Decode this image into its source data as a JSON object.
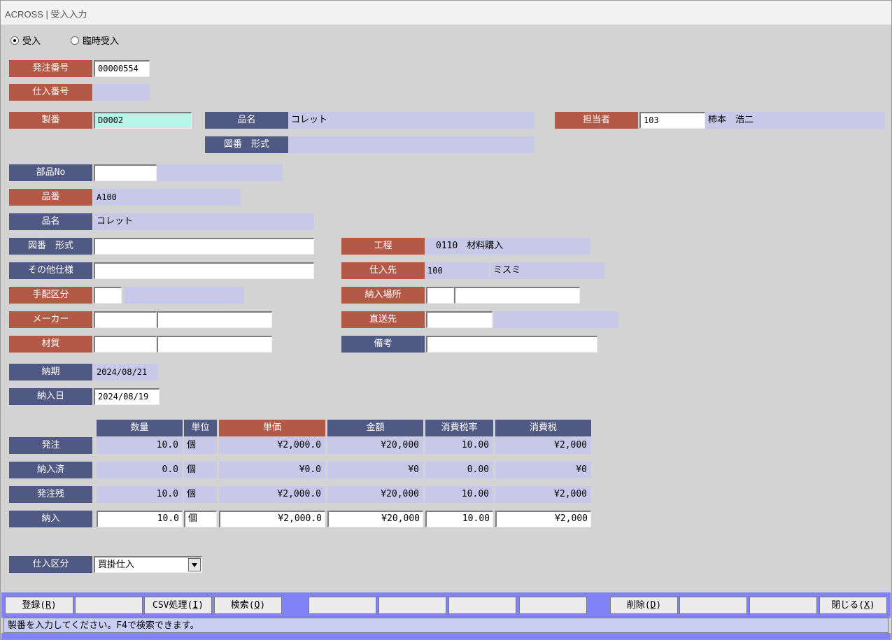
{
  "window": {
    "title": "ACROSS | 受入入力"
  },
  "mode": {
    "options": [
      "受入",
      "臨時受入"
    ],
    "selected": "受入"
  },
  "header": {
    "order_no_label": "発注番号",
    "order_no": "00000554",
    "purchase_no_label": "仕入番号",
    "purchase_no": "",
    "seiban_label": "製番",
    "seiban": "D0002",
    "product_name_label": "品名",
    "product_name": "コレット",
    "drawing_label": "図番　形式",
    "drawing": "",
    "staff_label": "担当者",
    "staff_code": "103",
    "staff_name": "柿本　浩二"
  },
  "part": {
    "part_no_label": "部品No",
    "part_no": "",
    "part_no_desc": "",
    "item_no_label": "品番",
    "item_no": "A100",
    "item_name_label": "品名",
    "item_name": "コレット",
    "drawing_label": "図番　形式",
    "drawing": "",
    "other_spec_label": "その他仕様",
    "other_spec": "",
    "arrange_label": "手配区分",
    "arrange_code": "",
    "arrange_name": "",
    "maker_label": "メーカー",
    "maker_code": "",
    "maker_name": "",
    "material_label": "材質",
    "material_code": "",
    "material_name": "",
    "process_label": "工程",
    "process": "0110　材料購入",
    "supplier_label": "仕入先",
    "supplier_code": "100",
    "supplier_name": "ミスミ",
    "delivery_place_label": "納入場所",
    "delivery_place_code": "",
    "delivery_place_name": "",
    "direct_ship_label": "直送先",
    "direct_ship_code": "",
    "direct_ship_name": "",
    "remarks_label": "備考",
    "remarks": ""
  },
  "dates": {
    "due_label": "納期",
    "due": "2024/08/21",
    "delivery_label": "納入日",
    "delivery": "2024/08/19"
  },
  "grid": {
    "columns": [
      "数量",
      "単位",
      "単価",
      "金額",
      "消費税率",
      "消費税"
    ],
    "rows": [
      {
        "label": "発注",
        "qty": "10.0",
        "unit": "個",
        "price": "¥2,000.0",
        "amount": "¥20,000",
        "rate": "10.00",
        "tax": "¥2,000"
      },
      {
        "label": "納入済",
        "qty": "0.0",
        "unit": "個",
        "price": "¥0.0",
        "amount": "¥0",
        "rate": "0.00",
        "tax": "¥0"
      },
      {
        "label": "発注残",
        "qty": "10.0",
        "unit": "個",
        "price": "¥2,000.0",
        "amount": "¥20,000",
        "rate": "10.00",
        "tax": "¥2,000"
      },
      {
        "label": "納入",
        "qty": "10.0",
        "unit": "個",
        "price": "¥2,000.0",
        "amount": "¥20,000",
        "rate": "10.00",
        "tax": "¥2,000"
      }
    ]
  },
  "purchase_type": {
    "label": "仕入区分",
    "value": "買掛仕入"
  },
  "toolbar": {
    "register": "登録(R)",
    "register_pre": "登録(",
    "register_key": "R",
    "csv_pre": "CSV処理(",
    "csv_key": "I",
    "search_pre": "検索(",
    "search_key": "Q",
    "delete_pre": "削除(",
    "delete_key": "D",
    "close_pre": "閉じる(",
    "close_key": "X",
    "suffix": ")"
  },
  "status": {
    "message": "製番を入力してください。F4で検索できます。"
  }
}
